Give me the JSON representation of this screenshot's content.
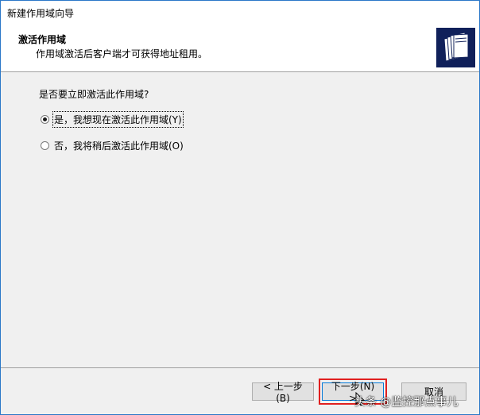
{
  "window": {
    "title": "新建作用域向导"
  },
  "header": {
    "title": "激活作用域",
    "subtitle": "作用域激活后客户端才可获得地址租用。",
    "icon": "folder-stack-icon"
  },
  "body": {
    "question": "是否要立即激活此作用域?",
    "options": [
      {
        "label": "是，我想现在激活此作用域(Y)",
        "checked": true
      },
      {
        "label": "否，我将稍后激活此作用域(O)",
        "checked": false
      }
    ]
  },
  "footer": {
    "back_label": "< 上一步(B)",
    "next_label": "下一步(N) >",
    "cancel_label": "取消"
  },
  "watermark": "头条 @监控那点事儿",
  "colors": {
    "highlight": "#e02020",
    "icon_bg": "#10205a"
  }
}
